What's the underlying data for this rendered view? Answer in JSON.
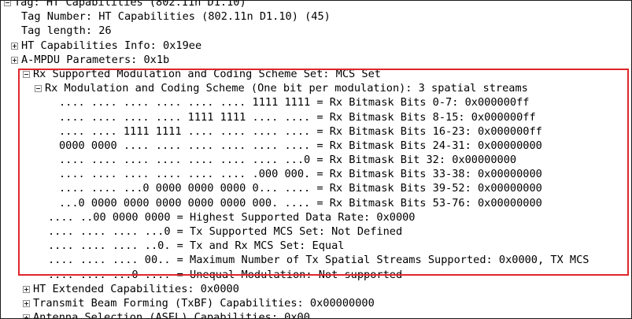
{
  "tree": {
    "rows": [
      {
        "text": "Tag: HT Capabilities (802.11n D1.10)",
        "expander": "minus"
      },
      {
        "text": "Tag Number: HT Capabilities (802.11n D1.10) (45)",
        "expander": "none"
      },
      {
        "text": "Tag length: 26",
        "expander": "none"
      },
      {
        "text": "HT Capabilities Info: 0x19ee",
        "expander": "plus"
      },
      {
        "text": "A-MPDU Parameters: 0x1b",
        "expander": "plus"
      },
      {
        "text": "Rx Supported Modulation and Coding Scheme Set: MCS Set",
        "expander": "minus"
      },
      {
        "text": "Rx Modulation and Coding Scheme (One bit per modulation): 3 spatial streams",
        "expander": "minus"
      },
      {
        "text": ".... .... .... .... .... .... 1111 1111 = Rx Bitmask Bits 0-7: 0x000000ff",
        "expander": "none"
      },
      {
        "text": ".... .... .... .... 1111 1111 .... .... = Rx Bitmask Bits 8-15: 0x000000ff",
        "expander": "none"
      },
      {
        "text": ".... .... 1111 1111 .... .... .... .... = Rx Bitmask Bits 16-23: 0x000000ff",
        "expander": "none"
      },
      {
        "text": "0000 0000 .... .... .... .... .... .... = Rx Bitmask Bits 24-31: 0x00000000",
        "expander": "none"
      },
      {
        "text": ".... .... .... .... .... .... .... ...0 = Rx Bitmask Bit 32: 0x00000000",
        "expander": "none"
      },
      {
        "text": ".... .... .... .... .... .... .000 000. = Rx Bitmask Bits 33-38: 0x00000000",
        "expander": "none"
      },
      {
        "text": ".... .... ...0 0000 0000 0000 0... .... = Rx Bitmask Bits 39-52: 0x00000000",
        "expander": "none"
      },
      {
        "text": "...0 0000 0000 0000 0000 0000 000. .... = Rx Bitmask Bits 53-76: 0x00000000",
        "expander": "none"
      },
      {
        "text": ".... ..00 0000 0000 = Highest Supported Data Rate: 0x0000",
        "expander": "none"
      },
      {
        "text": ".... .... .... ...0 = Tx Supported MCS Set: Not Defined",
        "expander": "none"
      },
      {
        "text": ".... .... .... ..0. = Tx and Rx MCS Set: Equal",
        "expander": "none"
      },
      {
        "text": ".... .... .... 00.. = Maximum Number of Tx Spatial Streams Supported: 0x0000, TX MCS",
        "expander": "none"
      },
      {
        "text": ".... .... ...0 .... = Unequal Modulation: Not supported",
        "expander": "none"
      },
      {
        "text": "HT Extended Capabilities: 0x0000",
        "expander": "plus"
      },
      {
        "text": "Transmit Beam Forming (TxBF) Capabilities: 0x00000000",
        "expander": "plus"
      },
      {
        "text": "Antenna Selection (ASEL) Capabilities: 0x00",
        "expander": "plus"
      }
    ]
  },
  "colors": {
    "highlight_border": "#e0262c",
    "frame_border": "#1a1a1a",
    "text": "#000000"
  }
}
